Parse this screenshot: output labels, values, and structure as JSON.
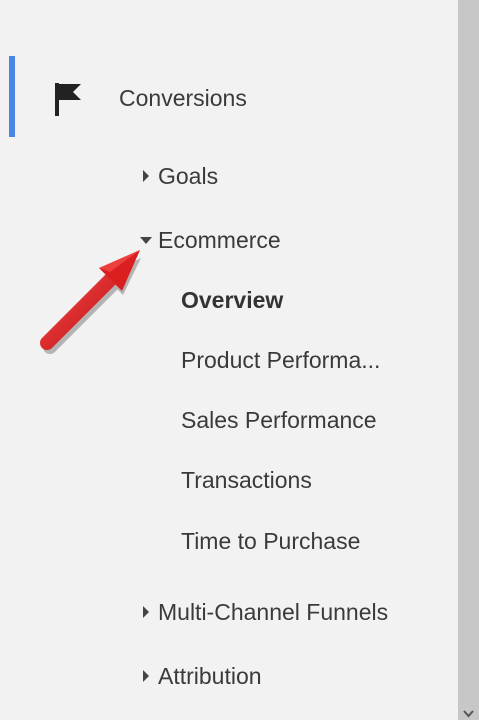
{
  "nav": {
    "section": {
      "label": "Conversions",
      "icon": "flag-icon"
    },
    "groups": [
      {
        "label": "Goals",
        "expanded": false
      },
      {
        "label": "Ecommerce",
        "expanded": true,
        "items": [
          {
            "label": "Overview",
            "active": true
          },
          {
            "label": "Product Performa...",
            "active": false
          },
          {
            "label": "Sales Performance",
            "active": false
          },
          {
            "label": "Transactions",
            "active": false
          },
          {
            "label": "Time to Purchase",
            "active": false
          }
        ]
      },
      {
        "label": "Multi-Channel Funnels",
        "expanded": false
      },
      {
        "label": "Attribution",
        "expanded": false
      }
    ]
  },
  "colors": {
    "active_indicator": "#4a86e8",
    "annotation_arrow": "#d91f1f",
    "scrollbar": "#c7c7c7",
    "background": "#f2f2f2"
  }
}
